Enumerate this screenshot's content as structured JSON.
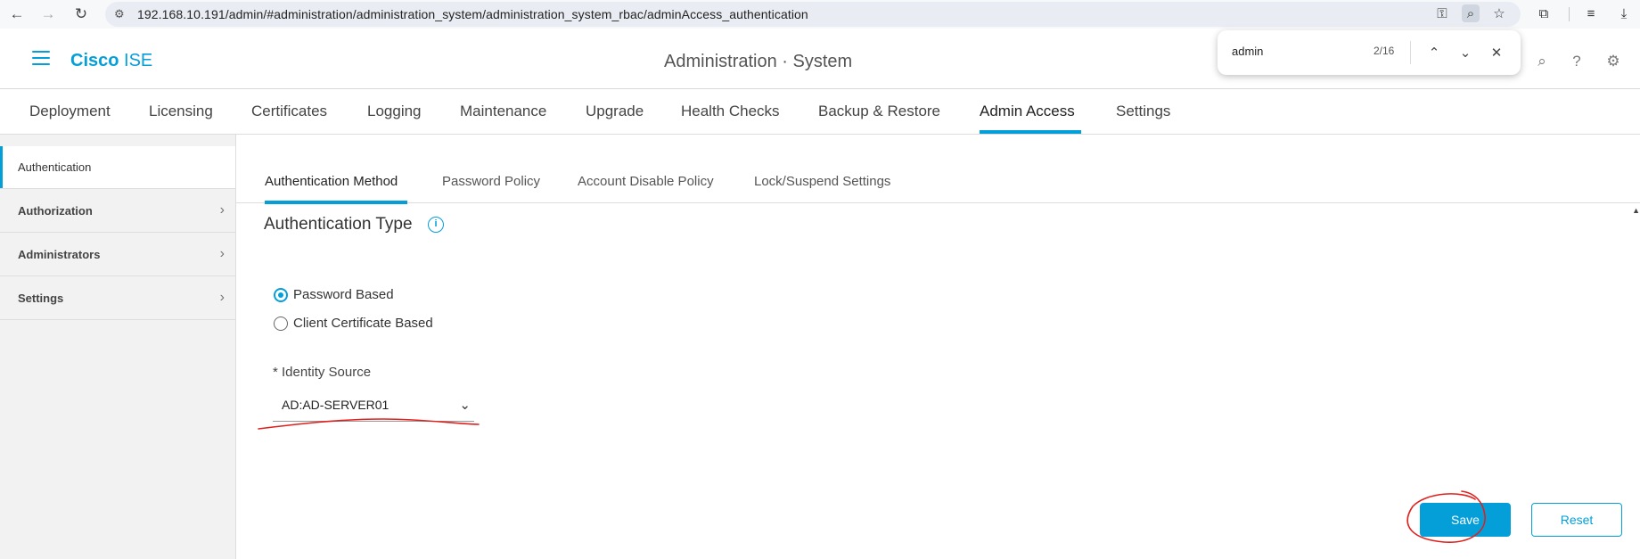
{
  "browser": {
    "url": "192.168.10.191/admin/#administration/administration_system/administration_system_rbac/adminAccess_authentication",
    "icons": [
      "back-icon",
      "forward-icon",
      "reload-icon",
      "site-info-icon",
      "password-key-icon",
      "find-in-page-icon",
      "bookmark-star-icon",
      "extensions-icon",
      "tab-search-icon",
      "download-icon"
    ]
  },
  "find": {
    "query": "admin",
    "count": "2/16"
  },
  "header": {
    "brand_bold": "Cisco",
    "brand_light": " ISE",
    "title": "Administration · System"
  },
  "main_tabs": [
    {
      "label": "Deployment"
    },
    {
      "label": "Licensing"
    },
    {
      "label": "Certificates"
    },
    {
      "label": "Logging"
    },
    {
      "label": "Maintenance"
    },
    {
      "label": "Upgrade"
    },
    {
      "label": "Health Checks"
    },
    {
      "label": "Backup & Restore"
    },
    {
      "label": "Admin Access",
      "active": true
    },
    {
      "label": "Settings"
    }
  ],
  "sidebar": {
    "items": [
      {
        "label": "Authentication",
        "active": true
      },
      {
        "label": "Authorization"
      },
      {
        "label": "Administrators"
      },
      {
        "label": "Settings"
      }
    ]
  },
  "sub_tabs": [
    {
      "label": "Authentication Method",
      "active": true
    },
    {
      "label": "Password Policy"
    },
    {
      "label": "Account Disable Policy"
    },
    {
      "label": "Lock/Suspend Settings"
    }
  ],
  "auth": {
    "section_title": "Authentication Type",
    "options": [
      {
        "label": "Password Based",
        "selected": true
      },
      {
        "label": "Client Certificate Based",
        "selected": false
      }
    ],
    "identity_label": "* Identity Source",
    "identity_value": "AD:AD-SERVER01"
  },
  "actions": {
    "save": "Save",
    "reset": "Reset"
  },
  "colors": {
    "accent": "#049fd9",
    "annotation": "#e0201c"
  }
}
